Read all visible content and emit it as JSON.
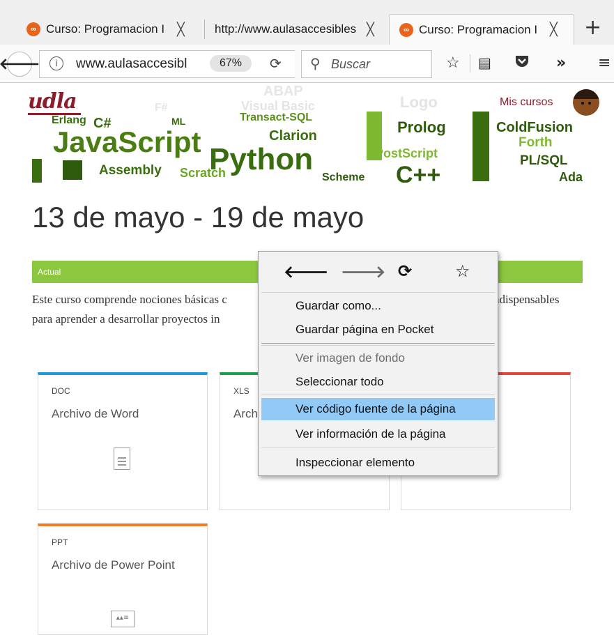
{
  "browser": {
    "tabs": [
      {
        "label": "Curso: Programacion I",
        "active": false
      },
      {
        "label": "http://www.aulasaccesibles",
        "active": false
      },
      {
        "label": "Curso: Programacion I",
        "active": true
      }
    ],
    "close_glyph": "╳",
    "new_tab_glyph": "+",
    "url": "www.aulasaccesibles",
    "zoom": "67%",
    "search_placeholder": "Buscar",
    "toolbar_icons": [
      "bookmark-star-icon",
      "reader-view-icon",
      "pocket-icon",
      "overflow-chevron-icon",
      "hamburger-menu-icon"
    ]
  },
  "page": {
    "logo_text": "udla",
    "header_link": "Mis cursos",
    "banner_words": [
      "JavaScript",
      "Python",
      "Prolog",
      "ColdFusion",
      "Forth",
      "PL/SQL",
      "Clarion",
      "PostScript",
      "Assembly",
      "Scratch",
      "C++",
      "C#",
      "F#",
      "ABAP",
      "Visual Basic",
      "Logo",
      "Erlang",
      "ML",
      "Transact-SQL",
      "Scheme",
      "Ada"
    ],
    "week_title": "13 de mayo - 19 de mayo",
    "current_label": "Actual",
    "description_line1": "Este curso comprende nociones básicas c",
    "description_line1_end": "ndispensables",
    "description_line2": "para aprender a desarrollar proyectos in",
    "cards": [
      {
        "type": "DOC",
        "name": "Archivo de Word",
        "accent": "#1b9ad6"
      },
      {
        "type": "XLS",
        "name": "Arch",
        "accent": "#1e9c4f"
      },
      {
        "type": "",
        "name": "",
        "accent": "#e2463f"
      },
      {
        "type": "PPT",
        "name": "Archivo de Power Point",
        "accent": "#ee7d25"
      }
    ]
  },
  "context_menu": {
    "nav_icons": [
      "back-arrow-icon",
      "forward-arrow-icon",
      "reload-icon",
      "bookmark-star-icon"
    ],
    "items": [
      {
        "label": "Guardar como...",
        "disabled": false,
        "highlighted": false
      },
      {
        "label": "Guardar página en Pocket",
        "disabled": false,
        "highlighted": false
      },
      {
        "label": "Ver imagen de fondo",
        "disabled": true,
        "highlighted": false
      },
      {
        "label": "Seleccionar todo",
        "disabled": false,
        "highlighted": false
      },
      {
        "label": "Ver código fuente de la página",
        "disabled": false,
        "highlighted": true
      },
      {
        "label": "Ver información de la página",
        "disabled": false,
        "highlighted": false
      },
      {
        "label": "Inspeccionar elemento",
        "disabled": false,
        "highlighted": false
      }
    ]
  },
  "colors": {
    "accent_green": "#8dc63f",
    "brand_red": "#8b1d2c",
    "menu_highlight": "#91c9f7"
  }
}
